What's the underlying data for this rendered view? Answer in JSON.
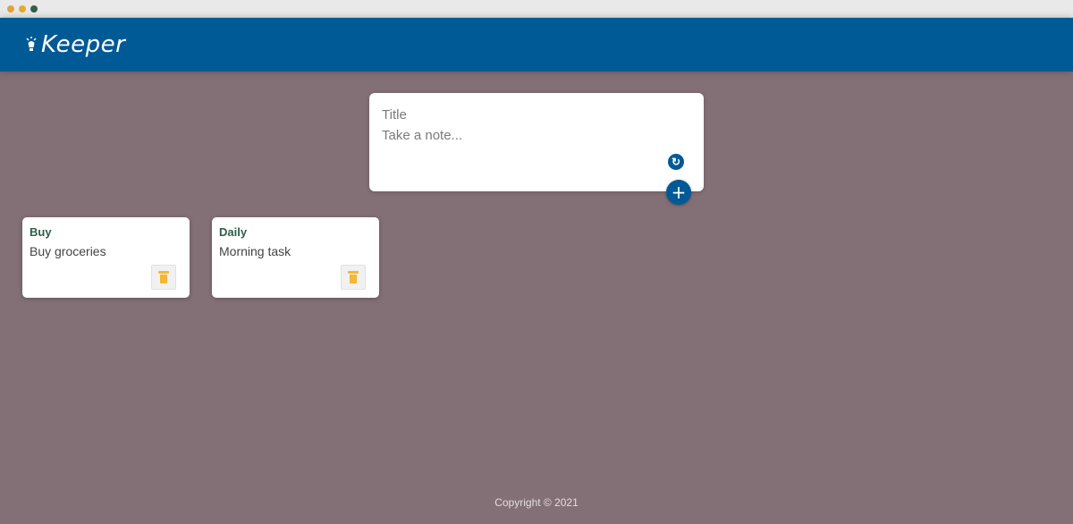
{
  "app": {
    "title": "Keeper",
    "accent_color": "#005a96",
    "background_color": "#836f76"
  },
  "compose": {
    "title_placeholder": "Title",
    "body_placeholder": "Take a note...",
    "refresh_icon": "refresh-icon",
    "add_icon": "plus-icon"
  },
  "notes": [
    {
      "title": "Buy",
      "content": "Buy groceries",
      "delete_icon": "trash-icon"
    },
    {
      "title": "Daily",
      "content": "Morning task",
      "delete_icon": "trash-icon"
    }
  ],
  "footer": {
    "text": "Copyright © 2021"
  }
}
